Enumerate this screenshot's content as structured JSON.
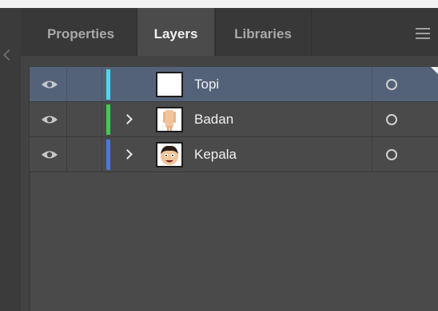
{
  "tabs": [
    {
      "label": "Properties",
      "active": false
    },
    {
      "label": "Layers",
      "active": true
    },
    {
      "label": "Libraries",
      "active": false
    }
  ],
  "menu_icon": "hamburger-menu-icon",
  "layers": [
    {
      "name": "Topi",
      "color": "#4fd6ef",
      "selected": true,
      "expandable": false,
      "visible": true,
      "thumbnail": "blank"
    },
    {
      "name": "Badan",
      "color": "#3fcc4f",
      "selected": false,
      "expandable": true,
      "visible": true,
      "thumbnail": "body"
    },
    {
      "name": "Kepala",
      "color": "#4a78e0",
      "selected": false,
      "expandable": true,
      "visible": true,
      "thumbnail": "face"
    }
  ],
  "colors": {
    "panel_bg": "#434343",
    "tabbar_bg": "#383838",
    "selected_row": "#546279"
  }
}
